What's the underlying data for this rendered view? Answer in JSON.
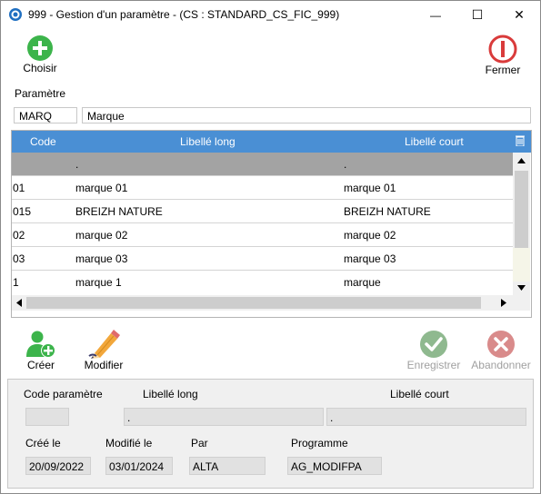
{
  "window": {
    "title": "999 - Gestion d'un paramètre - (CS : STANDARD_CS_FIC_999)",
    "minimize_glyph": "—",
    "maximize_glyph": "☐",
    "close_glyph": "✕"
  },
  "toolbar": {
    "choose_label": "Choisir",
    "close_label": "Fermer"
  },
  "parametre": {
    "section_label": "Paramètre",
    "code": "MARQ",
    "libelle": "Marque"
  },
  "grid": {
    "columns": {
      "code": "Code",
      "long": "Libellé long",
      "short": "Libellé court"
    },
    "rows": [
      {
        "code": "",
        "long": ".",
        "short": "."
      },
      {
        "code": "01",
        "long": "marque 01",
        "short": "marque 01"
      },
      {
        "code": "015",
        "long": "BREIZH NATURE",
        "short": "BREIZH NATURE"
      },
      {
        "code": "02",
        "long": "marque 02",
        "short": "marque 02"
      },
      {
        "code": "03",
        "long": "marque 03",
        "short": "marque 03"
      },
      {
        "code": "1",
        "long": "marque 1",
        "short": "marque"
      }
    ]
  },
  "actions": {
    "create_label": "Créer",
    "modify_label": "Modifier",
    "save_label": "Enregistrer",
    "abandon_label": "Abandonner"
  },
  "detail": {
    "code_label": "Code paramètre",
    "long_label": "Libellé long",
    "short_label": "Libellé court",
    "code_value": "",
    "long_value": ".",
    "short_value": ".",
    "created_label": "Créé le",
    "modified_label": "Modifié le",
    "by_label": "Par",
    "program_label": "Programme",
    "created_value": "20/09/2022",
    "modified_value": "03/01/2024",
    "by_value": "ALTA",
    "program_value": "AG_MODIFPA"
  },
  "colors": {
    "accent": "#4a8fd4",
    "selected_row": "#a3a3a3",
    "choose_green": "#3cb44b",
    "close_red": "#d93b3b"
  }
}
